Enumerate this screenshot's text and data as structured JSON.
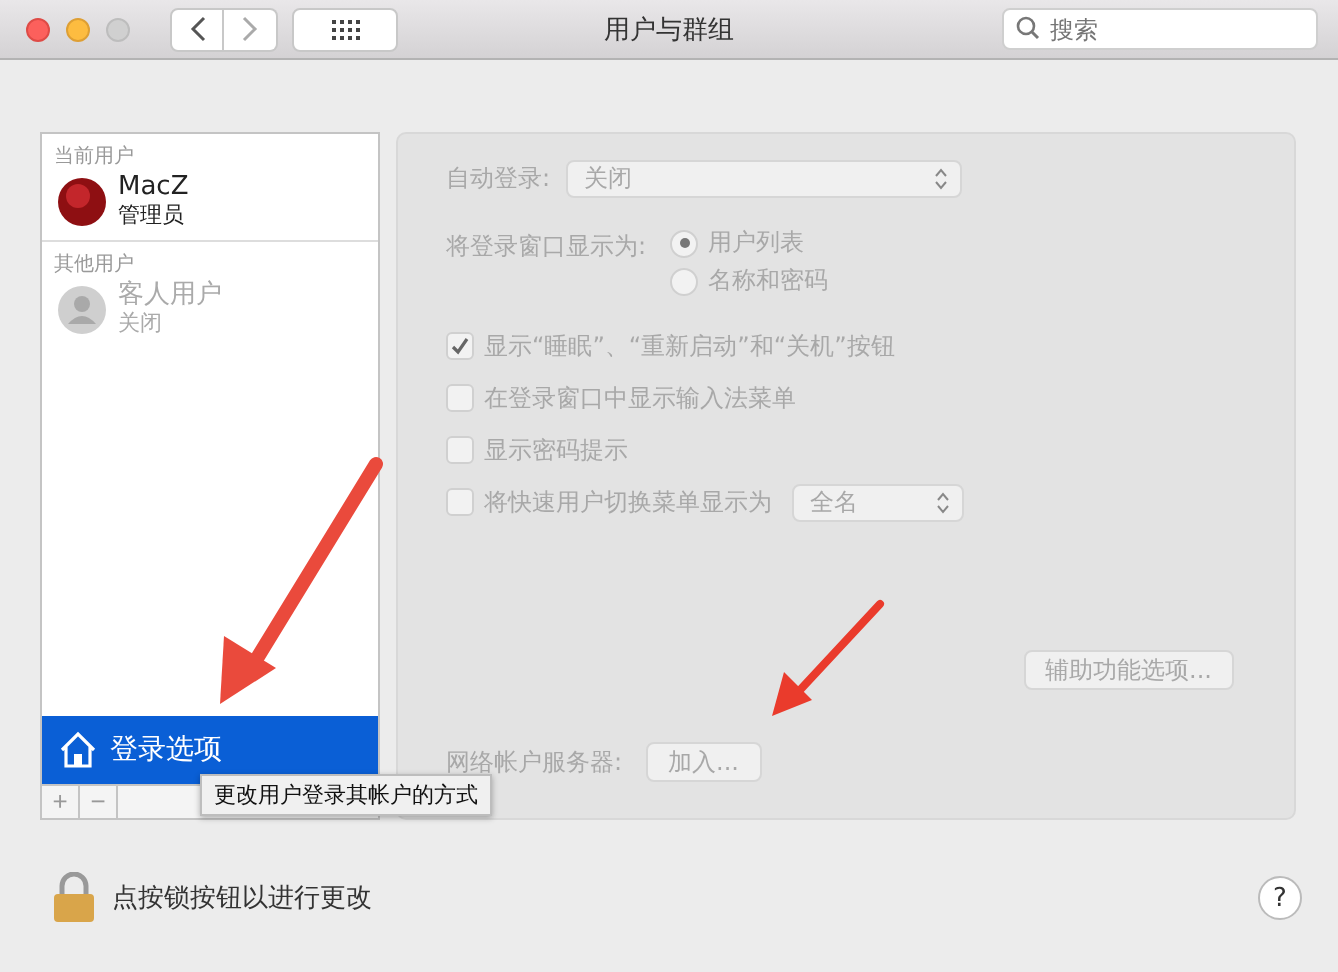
{
  "window": {
    "title": "用户与群组"
  },
  "search": {
    "placeholder": "搜索"
  },
  "users": {
    "sections": [
      {
        "heading": "当前用户",
        "users": [
          {
            "name": "MacZ",
            "role": "管理员",
            "kind": "admin",
            "disabled": false
          }
        ]
      },
      {
        "heading": "其他用户",
        "users": [
          {
            "name": "客人用户",
            "role": "关闭",
            "kind": "guest",
            "disabled": true
          }
        ]
      }
    ],
    "login_options": {
      "label": "登录选项",
      "selected": true
    },
    "buttons": [
      "+",
      "−"
    ]
  },
  "tooltip": "更改用户登录其帐户的方式",
  "options": {
    "disabled": true,
    "auto_login": {
      "label": "自动登录:",
      "value": "关闭"
    },
    "display_as": {
      "label": "将登录窗口显示为:",
      "choices": [
        {
          "label": "用户列表",
          "selected": true
        },
        {
          "label": "名称和密码",
          "selected": false
        }
      ]
    },
    "checkboxes": [
      {
        "label": "显示“睡眠”、“重新启动”和“关机”按钮",
        "checked": true
      },
      {
        "label": "在登录窗口中显示输入法菜单",
        "checked": false
      },
      {
        "label": "显示密码提示",
        "checked": false
      },
      {
        "label": "将快速用户切换菜单显示为",
        "checked": false,
        "popup": "全名"
      }
    ],
    "accessibility_button": "辅助功能选项...",
    "network_server": {
      "label": "网络帐户服务器:",
      "button": "加入..."
    }
  },
  "footer": {
    "lock_text": "点按锁按钮以进行更改",
    "help": "?"
  }
}
